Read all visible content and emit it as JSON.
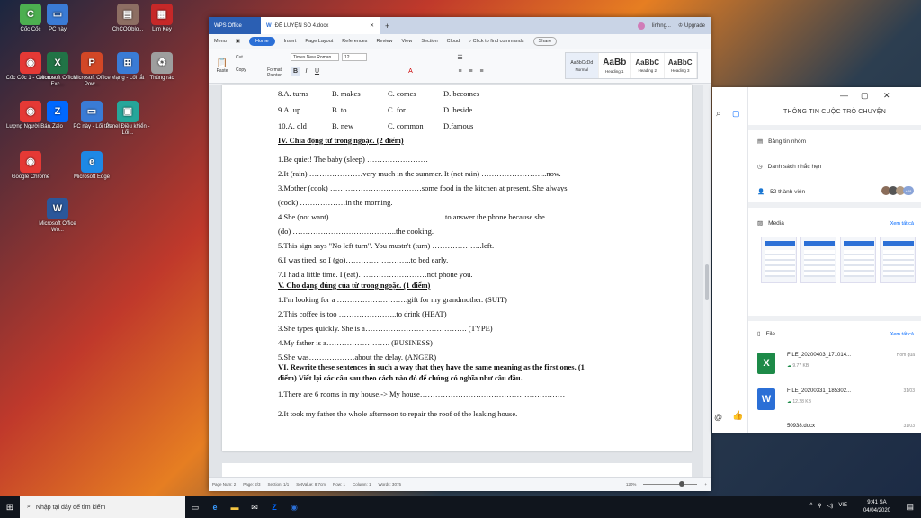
{
  "desktop": {
    "icons": [
      {
        "label": "Cốc Cốc",
        "color": "#4caf50",
        "glyph": "C"
      },
      {
        "label": "PC này",
        "color": "#3a7bd5",
        "glyph": "▭"
      },
      {
        "label": "ChCOOblo...",
        "color": "#8d6e63",
        "glyph": "▤"
      },
      {
        "label": "Lim Key",
        "color": "#c62828",
        "glyph": "▦"
      },
      {
        "label": "Cốc Cốc 1 - Chrome",
        "color": "#e53935",
        "glyph": "◉"
      },
      {
        "label": "Microsoft Office Exc...",
        "color": "#217346",
        "glyph": "X"
      },
      {
        "label": "Microsoft Office Pow...",
        "color": "#d24726",
        "glyph": "P"
      },
      {
        "label": "Mạng - Lối tắt",
        "color": "#3a7bd5",
        "glyph": "⊞"
      },
      {
        "label": "Thùng rác",
        "color": "#9e9e9e",
        "glyph": "♻"
      },
      {
        "label": "Lượng Người Bán...",
        "color": "#e53935",
        "glyph": "◉"
      },
      {
        "label": "Zalo",
        "color": "#0068ff",
        "glyph": "Z"
      },
      {
        "label": "PC này - Lối tắt",
        "color": "#3a7bd5",
        "glyph": "▭"
      },
      {
        "label": "Panel Điều khiển - Lối...",
        "color": "#26a69a",
        "glyph": "▣"
      },
      {
        "label": "Google Chrome",
        "color": "#e53935",
        "glyph": "◉"
      },
      {
        "label": "Microsoft Edge",
        "color": "#1e88e5",
        "glyph": "e"
      },
      {
        "label": "Microsoft Office Wo...",
        "color": "#2b579a",
        "glyph": "W"
      }
    ]
  },
  "wps": {
    "tab_home": "WPS Office",
    "tab_doc": "ĐỀ LUYỆN SỐ 4.docx",
    "user": "linhng...",
    "upgrade": "Upgrade",
    "menus": [
      "Menu",
      "Home",
      "Insert",
      "Page Layout",
      "References",
      "Review",
      "View",
      "Section",
      "Cloud"
    ],
    "find": "Click to find commands",
    "share": "Share",
    "paste": "Paste",
    "format_painter": "Format Painter",
    "cut": "Cut",
    "copy": "Copy",
    "font": "Times New Roman",
    "size": "12",
    "styles": [
      {
        "preview": "AaBbCcDd",
        "name": "Normal"
      },
      {
        "preview": "AaBb",
        "name": "Heading 1"
      },
      {
        "preview": "AaBbC",
        "name": "Heading 2"
      },
      {
        "preview": "AaBbC",
        "name": "Heading 3"
      }
    ],
    "status": {
      "page_num": "Page Num: 2",
      "page": "Page: 2/3",
      "section": "Section: 1/1",
      "set_value": "SetValue: 8.7cm",
      "row": "Row: 1",
      "column": "Column: 1",
      "words": "Words: 3075",
      "zoom": "120%"
    }
  },
  "document": {
    "options": [
      {
        "a": "8.A. turns",
        "b": "B. makes",
        "c": "C. comes",
        "d": "D. becomes"
      },
      {
        "a": "9.A. up",
        "b": "B. to",
        "c": "C. for",
        "d": "D. beside"
      },
      {
        "a": "10.A. old",
        "b": "B. new",
        "c": "C. common",
        "d": "D.famous"
      }
    ],
    "lines": [
      {
        "text": "IV. Chia động từ trong ngoặc. (2 điểm)",
        "bold": true
      },
      {
        "text": "1.Be quiet! The baby (sleep) ……………………",
        "bold": false
      },
      {
        "text": "2.It (rain) …………………very much in the summer. It (not rain) ……………………..now.",
        "bold": false
      },
      {
        "text": "3.Mother (cook) ………………………………some food in the kitchen at present. She always",
        "bold": false
      },
      {
        "text": "(cook) ………………in the morning.",
        "bold": false
      },
      {
        "text": "4.She (not want) ………………………………………to answer the phone because she",
        "bold": false
      },
      {
        "text": "(do) …………………………………..the cooking.",
        "bold": false
      },
      {
        "text": "5.This sign says \"No left turn\". You mustn't (turn) ………………..left.",
        "bold": false
      },
      {
        "text": "6.I was tired, so I (go)……………………..to bed early.",
        "bold": false
      },
      {
        "text": "7.I had a little time. I (eat)………………………not phone you.",
        "bold": false
      },
      {
        "text": "V. Cho dạng đúng của từ trong ngoặc. (1 điểm)",
        "bold": true
      },
      {
        "text": "1.I'm looking for a ……………………….gift for my grandmother. (SUIT)",
        "bold": false
      },
      {
        "text": "2.This coffee is too …………………..to drink (HEAT)",
        "bold": false
      },
      {
        "text": "3.She types quickly. She is a…………………………………. (TYPE)",
        "bold": false
      },
      {
        "text": "4.My father is a……………………. (BUSINESS)",
        "bold": false
      },
      {
        "text": "5.She was………………about the delay. (ANGER)",
        "bold": false
      },
      {
        "text": "VI. Rewrite these sentences in such a way that they have the same meaning as the first ones. (1",
        "bold": true
      },
      {
        "text": "điểm) Viết lại các câu sau theo cách nào đó để chúng có nghĩa như câu đầu.",
        "bold": true
      },
      {
        "text": "1.There are 6 rooms in my house.-> My house…………………………………………………",
        "bold": false
      },
      {
        "text": "2.It took my father the whole afternoon to repair the roof of the leaking house.",
        "bold": false
      }
    ]
  },
  "zalo": {
    "title": "THÔNG TIN CUỘC TRÒ CHUYỆN",
    "board": "Bảng tin nhóm",
    "reminders": "Danh sách nhắc hẹn",
    "members": "52 thành viên",
    "member_more": "+48",
    "media": "Media",
    "see_all": "Xem tất cả",
    "file_section": "File",
    "files": [
      {
        "name": "FILE_20200403_171014...",
        "size": "9.77 KB",
        "date": "Hôm qua",
        "type": "X",
        "color": "#1d8a48"
      },
      {
        "name": "FILE_20200331_185302...",
        "size": "12.28 KB",
        "date": "31/03",
        "type": "W",
        "color": "#2b6fd6"
      },
      {
        "name": "50938.docx",
        "size": "",
        "date": "31/03",
        "type": "",
        "color": ""
      }
    ]
  },
  "taskbar": {
    "search_placeholder": "Nhập tại đây để tìm kiếm",
    "lang": "VIE",
    "time": "9:41 SA",
    "date": "04/04/2020"
  }
}
